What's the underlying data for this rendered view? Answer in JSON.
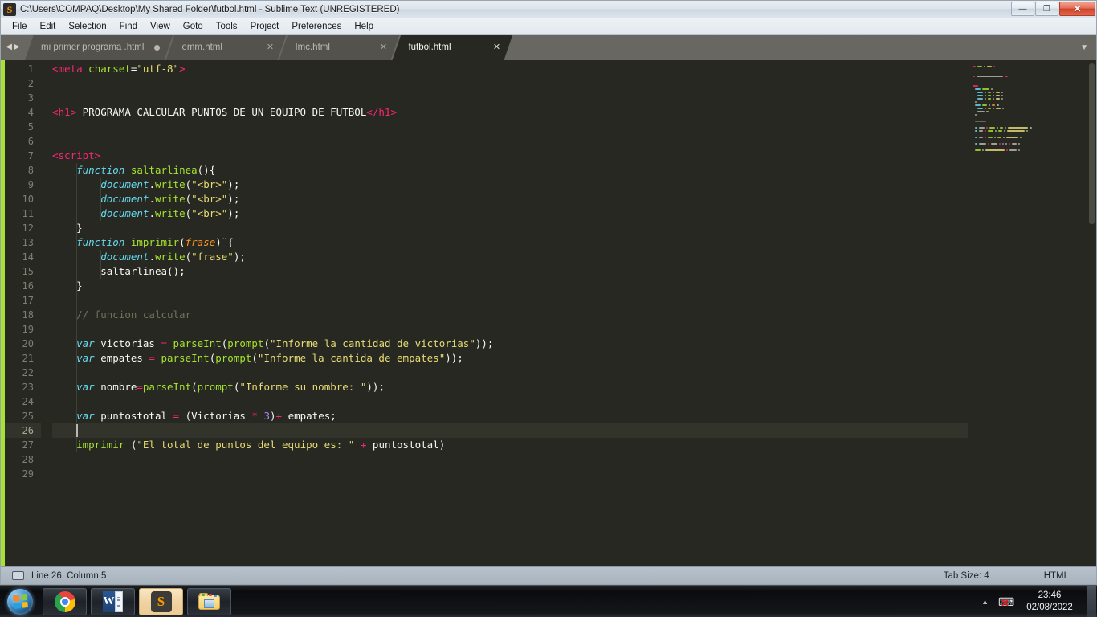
{
  "window": {
    "title": "C:\\Users\\COMPAQ\\Desktop\\My Shared Folder\\futbol.html - Sublime Text (UNREGISTERED)",
    "app_icon_glyph": "S",
    "controls": {
      "minimize_label": "—",
      "restore_label": "❐",
      "close_label": "✕"
    }
  },
  "menubar": {
    "items": [
      {
        "label": "File"
      },
      {
        "label": "Edit"
      },
      {
        "label": "Selection"
      },
      {
        "label": "Find"
      },
      {
        "label": "View"
      },
      {
        "label": "Goto"
      },
      {
        "label": "Tools"
      },
      {
        "label": "Project"
      },
      {
        "label": "Preferences"
      },
      {
        "label": "Help"
      }
    ]
  },
  "tabbar": {
    "nav_prev_glyph": "◀",
    "nav_next_glyph": "▶",
    "overflow_glyph": "▼",
    "close_glyph": "✕",
    "tabs": [
      {
        "label": "mi primer programa .html",
        "active": false,
        "dirty": true
      },
      {
        "label": "emm.html",
        "active": false,
        "dirty": false
      },
      {
        "label": "Imc.html",
        "active": false,
        "dirty": false
      },
      {
        "label": "futbol.html",
        "active": true,
        "dirty": false
      }
    ]
  },
  "editor": {
    "total_lines": 29,
    "current_line": 26,
    "cursor_column": 5,
    "lines": [
      {
        "n": 1,
        "tokens": [
          [
            "t-tag",
            "<meta"
          ],
          [
            "t-plain",
            " "
          ],
          [
            "t-attr",
            "charset"
          ],
          [
            "t-plain",
            "="
          ],
          [
            "t-str",
            "\"utf-8\""
          ],
          [
            "t-tag",
            ">"
          ]
        ]
      },
      {
        "n": 2,
        "tokens": []
      },
      {
        "n": 3,
        "tokens": []
      },
      {
        "n": 4,
        "tokens": [
          [
            "t-tag",
            "<h1>"
          ],
          [
            "t-plain",
            " PROGRAMA CALCULAR PUNTOS DE UN EQUIPO DE FUTBOL"
          ],
          [
            "t-tag",
            "</h1>"
          ]
        ]
      },
      {
        "n": 5,
        "tokens": []
      },
      {
        "n": 6,
        "tokens": []
      },
      {
        "n": 7,
        "tokens": [
          [
            "t-tag",
            "<script>"
          ]
        ]
      },
      {
        "n": 8,
        "tokens": [
          [
            "t-plain",
            "    "
          ],
          [
            "t-kw",
            "function"
          ],
          [
            "t-plain",
            " "
          ],
          [
            "t-fn",
            "saltarlinea"
          ],
          [
            "t-punct",
            "(){"
          ]
        ]
      },
      {
        "n": 9,
        "tokens": [
          [
            "t-plain",
            "        "
          ],
          [
            "t-obj",
            "document"
          ],
          [
            "t-punct",
            "."
          ],
          [
            "t-fn",
            "write"
          ],
          [
            "t-punct",
            "("
          ],
          [
            "t-str",
            "\"<br>\""
          ],
          [
            "t-punct",
            ");"
          ]
        ]
      },
      {
        "n": 10,
        "tokens": [
          [
            "t-plain",
            "        "
          ],
          [
            "t-obj",
            "document"
          ],
          [
            "t-punct",
            "."
          ],
          [
            "t-fn",
            "write"
          ],
          [
            "t-punct",
            "("
          ],
          [
            "t-str",
            "\"<br>\""
          ],
          [
            "t-punct",
            ");"
          ]
        ]
      },
      {
        "n": 11,
        "tokens": [
          [
            "t-plain",
            "        "
          ],
          [
            "t-obj",
            "document"
          ],
          [
            "t-punct",
            "."
          ],
          [
            "t-fn",
            "write"
          ],
          [
            "t-punct",
            "("
          ],
          [
            "t-str",
            "\"<br>\""
          ],
          [
            "t-punct",
            ");"
          ]
        ]
      },
      {
        "n": 12,
        "tokens": [
          [
            "t-plain",
            "    "
          ],
          [
            "t-punct",
            "}"
          ]
        ]
      },
      {
        "n": 13,
        "tokens": [
          [
            "t-plain",
            "    "
          ],
          [
            "t-kw",
            "function"
          ],
          [
            "t-plain",
            " "
          ],
          [
            "t-fn",
            "imprimir"
          ],
          [
            "t-punct",
            "("
          ],
          [
            "t-param",
            "frase"
          ],
          [
            "t-punct",
            ")¨{"
          ]
        ]
      },
      {
        "n": 14,
        "tokens": [
          [
            "t-plain",
            "        "
          ],
          [
            "t-obj",
            "document"
          ],
          [
            "t-punct",
            "."
          ],
          [
            "t-fn",
            "write"
          ],
          [
            "t-punct",
            "("
          ],
          [
            "t-str",
            "\"frase\""
          ],
          [
            "t-punct",
            ");"
          ]
        ]
      },
      {
        "n": 15,
        "tokens": [
          [
            "t-plain",
            "        "
          ],
          [
            "t-plain",
            "saltarlinea"
          ],
          [
            "t-punct",
            "();"
          ]
        ]
      },
      {
        "n": 16,
        "tokens": [
          [
            "t-plain",
            "    "
          ],
          [
            "t-punct",
            "}"
          ]
        ]
      },
      {
        "n": 17,
        "tokens": []
      },
      {
        "n": 18,
        "tokens": [
          [
            "t-plain",
            "    "
          ],
          [
            "t-com",
            "// funcion calcular"
          ]
        ]
      },
      {
        "n": 19,
        "tokens": []
      },
      {
        "n": 20,
        "tokens": [
          [
            "t-plain",
            "    "
          ],
          [
            "t-kw",
            "var"
          ],
          [
            "t-plain",
            " victorias "
          ],
          [
            "t-op",
            "="
          ],
          [
            "t-plain",
            " "
          ],
          [
            "t-fn",
            "parseInt"
          ],
          [
            "t-punct",
            "("
          ],
          [
            "t-fn",
            "prompt"
          ],
          [
            "t-punct",
            "("
          ],
          [
            "t-str",
            "\"Informe la cantidad de victorias\""
          ],
          [
            "t-punct",
            "));"
          ]
        ]
      },
      {
        "n": 21,
        "tokens": [
          [
            "t-plain",
            "    "
          ],
          [
            "t-kw",
            "var"
          ],
          [
            "t-plain",
            " empates "
          ],
          [
            "t-op",
            "="
          ],
          [
            "t-plain",
            " "
          ],
          [
            "t-fn",
            "parseInt"
          ],
          [
            "t-punct",
            "("
          ],
          [
            "t-fn",
            "prompt"
          ],
          [
            "t-punct",
            "("
          ],
          [
            "t-str",
            "\"Informe la cantida de empates\""
          ],
          [
            "t-punct",
            "));"
          ]
        ]
      },
      {
        "n": 22,
        "tokens": []
      },
      {
        "n": 23,
        "tokens": [
          [
            "t-plain",
            "    "
          ],
          [
            "t-kw",
            "var"
          ],
          [
            "t-plain",
            " nombre"
          ],
          [
            "t-op",
            "="
          ],
          [
            "t-fn",
            "parseInt"
          ],
          [
            "t-punct",
            "("
          ],
          [
            "t-fn",
            "prompt"
          ],
          [
            "t-punct",
            "("
          ],
          [
            "t-str",
            "\"Informe su nombre: \""
          ],
          [
            "t-punct",
            "));"
          ]
        ]
      },
      {
        "n": 24,
        "tokens": []
      },
      {
        "n": 25,
        "tokens": [
          [
            "t-plain",
            "    "
          ],
          [
            "t-kw",
            "var"
          ],
          [
            "t-plain",
            " puntostotal "
          ],
          [
            "t-op",
            "="
          ],
          [
            "t-plain",
            " "
          ],
          [
            "t-punct",
            "(Victorias "
          ],
          [
            "t-op",
            "*"
          ],
          [
            "t-plain",
            " "
          ],
          [
            "t-num",
            "3"
          ],
          [
            "t-punct",
            ")"
          ],
          [
            "t-op",
            "+"
          ],
          [
            "t-plain",
            " empates"
          ],
          [
            "t-punct",
            ";"
          ]
        ]
      },
      {
        "n": 26,
        "tokens": []
      },
      {
        "n": 27,
        "tokens": [
          [
            "t-plain",
            "    "
          ],
          [
            "t-fn",
            "imprimir"
          ],
          [
            "t-plain",
            " "
          ],
          [
            "t-punct",
            "("
          ],
          [
            "t-str",
            "\"El total de puntos del equipo es: \""
          ],
          [
            "t-plain",
            " "
          ],
          [
            "t-op",
            "+"
          ],
          [
            "t-plain",
            " puntostotal"
          ],
          [
            "t-punct",
            ")"
          ]
        ]
      },
      {
        "n": 28,
        "tokens": []
      },
      {
        "n": 29,
        "tokens": []
      }
    ]
  },
  "statusbar": {
    "position": "Line 26, Column 5",
    "tab_size": "Tab Size: 4",
    "syntax": "HTML"
  },
  "taskbar": {
    "start_label": "Start",
    "buttons": [
      {
        "name": "chrome",
        "label": "Google Chrome",
        "active": false
      },
      {
        "name": "word",
        "label": "Microsoft Word",
        "active": false,
        "glyph": "W"
      },
      {
        "name": "sublime",
        "label": "Sublime Text",
        "active": true,
        "glyph": "S"
      },
      {
        "name": "explorer",
        "label": "File Explorer",
        "active": false
      }
    ],
    "tray": {
      "arrow_glyph": "▲",
      "network_glyph": "⌨",
      "network_error_glyph": "✕",
      "time": "23:46",
      "date": "02/08/2022"
    }
  },
  "colors": {
    "editor_bg": "#272822",
    "gutter_fg": "#7d7f73",
    "current_line_bg": "#32332b",
    "accent_green": "#a6e22e",
    "accent_pink": "#f92672",
    "accent_cyan": "#66d9ef",
    "accent_yellow": "#e6db74",
    "accent_purple": "#ae81ff",
    "accent_orange": "#fd971f",
    "comment": "#75715e",
    "tabbar_bg": "#686761",
    "tab_inactive_bg": "#53524d",
    "statusbar_bg": "#b0bac4"
  }
}
